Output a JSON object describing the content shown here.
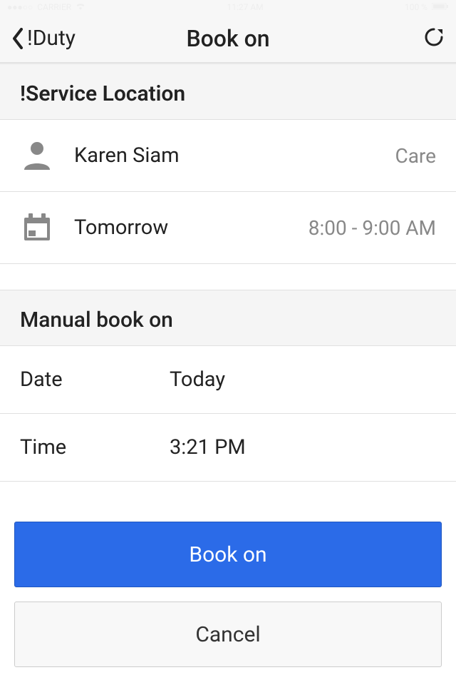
{
  "status": {
    "carrier": "CARRIER",
    "time": "11:27 AM",
    "battery": "100 %"
  },
  "nav": {
    "back_label": "!Duty",
    "title": "Book on"
  },
  "service_location": {
    "header": "!Service Location",
    "person": {
      "name": "Karen Siam",
      "role": "Care"
    },
    "schedule": {
      "day": "Tomorrow",
      "time": "8:00 - 9:00 AM"
    }
  },
  "manual": {
    "header": "Manual book on",
    "date_label": "Date",
    "date_value": "Today",
    "time_label": "Time",
    "time_value": "3:21 PM"
  },
  "buttons": {
    "primary": "Book on",
    "secondary": "Cancel"
  }
}
